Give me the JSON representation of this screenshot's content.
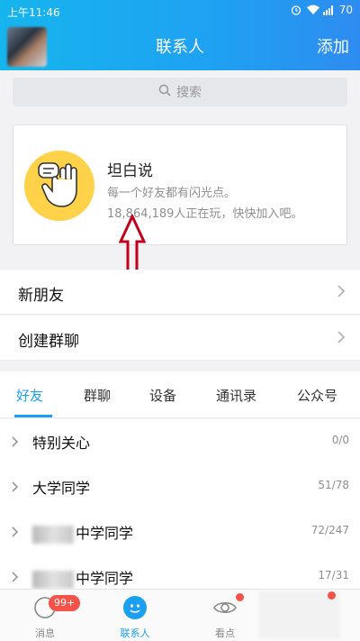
{
  "status_bar": {
    "time": "上午11:46",
    "battery": "70"
  },
  "header": {
    "title": "联系人",
    "add_label": "添加"
  },
  "search": {
    "placeholder": "搜索"
  },
  "banner": {
    "title": "坦白说",
    "subtitle": "每一个好友都有闪光点。",
    "count_text": "18,864,189人正在玩，快快加入吧。"
  },
  "rows": {
    "new_friends": "新朋友",
    "create_group": "创建群聊"
  },
  "tabs": [
    "好友",
    "群聊",
    "设备",
    "通讯录",
    "公众号"
  ],
  "groups": [
    {
      "name": "特别关心",
      "count": "0/0",
      "blurred": false
    },
    {
      "name": "大学同学",
      "count": "51/78",
      "blurred": false
    },
    {
      "name": "中学同学",
      "count": "72/247",
      "blurred": true
    },
    {
      "name": "中学同学",
      "count": "17/31",
      "blurred": true
    }
  ],
  "bottom_nav": {
    "messages": "消息",
    "messages_badge": "99+",
    "contacts": "联系人",
    "kandian": "看点"
  },
  "colors": {
    "accent": "#1b9ff0",
    "badge": "#f5524a",
    "banner_circle": "#ffd24a",
    "arrow": "#c0001a"
  }
}
